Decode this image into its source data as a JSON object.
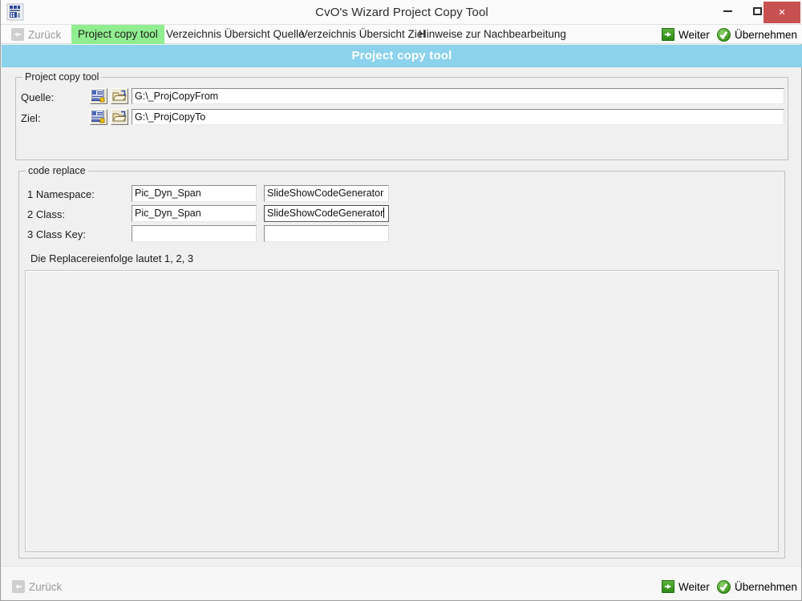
{
  "window": {
    "title": "CvO's Wizard Project Copy Tool",
    "app_icon": "wizard-app-icon",
    "controls": {
      "minimize_label": "Minimize",
      "maximize_label": "Maximize",
      "close_label": "×",
      "close_color": "#c75050"
    }
  },
  "tabbar": {
    "back_label": "Zurück",
    "tabs": [
      {
        "label": "Project copy tool",
        "active": true
      },
      {
        "label": "Verzeichnis Übersicht Quelle",
        "active": false
      },
      {
        "label": "Verzeichnis Übersicht Ziel",
        "active": false
      },
      {
        "label": "Hinweise zur Nachbearbeitung",
        "active": false
      }
    ],
    "next_label": "Weiter",
    "apply_label": "Übernehmen",
    "active_tab_color": "#90ee90"
  },
  "page_header": {
    "title": "Project copy tool",
    "background": "#8bd2ec",
    "text_color": "#ffffff"
  },
  "project_copy_tool_group": {
    "legend": "Project copy tool",
    "rows": [
      {
        "label": "Quelle:",
        "pick_icon": "browse-list-icon",
        "folder_icon": "open-folder-icon",
        "value": "G:\\_ProjCopyFrom",
        "placeholder": ""
      },
      {
        "label": "Ziel:",
        "pick_icon": "browse-list-icon",
        "folder_icon": "open-folder-icon",
        "value": "G:\\_ProjCopyTo",
        "placeholder": ""
      }
    ]
  },
  "code_replace_group": {
    "legend": "code replace",
    "rows": [
      {
        "label": "1 Namespace:",
        "search_value": "Pic_Dyn_Span",
        "replace_value": "SlideShowCodeGenerator",
        "search_focused": false,
        "replace_focused": false
      },
      {
        "label": "2 Class:",
        "search_value": "Pic_Dyn_Span",
        "replace_value": "SlideShowCodeGenerator",
        "search_focused": false,
        "replace_focused": true
      },
      {
        "label": "3 Class Key:",
        "search_value": "",
        "replace_value": "",
        "search_focused": false,
        "replace_focused": false
      }
    ],
    "hint": "Die Replacereienfolge lautet 1, 2, 3"
  },
  "bottombar": {
    "back_label": "Zurück",
    "next_label": "Weiter",
    "apply_label": "Übernehmen"
  }
}
